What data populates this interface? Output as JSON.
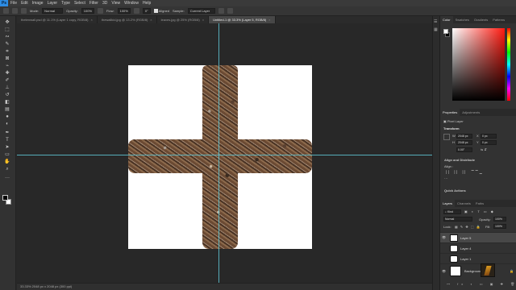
{
  "menu": {
    "logo": "Ps",
    "items": [
      "File",
      "Edit",
      "Image",
      "Layer",
      "Type",
      "Select",
      "Filter",
      "3D",
      "View",
      "Window",
      "Help"
    ]
  },
  "options": {
    "mode_label": "Mode:",
    "mode_value": "Normal",
    "opacity_label": "Opacity:",
    "opacity_value": "100%",
    "flow_label": "Flow:",
    "flow_value": "100%",
    "angle_value": "0°",
    "aligned_label": "Aligned",
    "sample_label": "Sample:",
    "sample_value": "Current Layer"
  },
  "tabs": [
    {
      "label": "thetenwall.psd @ 11.1% (Layer 1 copy, RGB/8)",
      "active": false
    },
    {
      "label": "thewallkid.jpg @ 13.2% (RGB/8)",
      "active": false
    },
    {
      "label": "leaves.jpg @ 25% (RGB/8)",
      "active": false
    },
    {
      "label": "Untitled-1 @ 33.3% (Layer 5, RGB/8)",
      "active": true
    }
  ],
  "status": {
    "text": "33.33%    2048 px x 2048 px (300 ppi)"
  },
  "color_panel": {
    "tabs": [
      "Color",
      "Swatches",
      "Gradients",
      "Patterns"
    ],
    "foreground": "#ffffff",
    "background": "#000000"
  },
  "properties_panel": {
    "tabs": [
      "Properties",
      "Adjustments"
    ],
    "layer_type": "Pixel Layer",
    "transform_title": "Transform",
    "w_label": "W",
    "w_value": "2048 px",
    "h_label": "H",
    "h_value": "2048 px",
    "x_label": "X",
    "x_value": "0 px",
    "y_label": "Y",
    "y_value": "0 px",
    "angle_value": "0.00°",
    "align_title": "Align and Distribute",
    "align_sub": "Align :",
    "quick_actions_title": "Quick Actions"
  },
  "layers_panel": {
    "tabs": [
      "Layers",
      "Channels",
      "Paths"
    ],
    "kind_label": "Kind",
    "blend_mode": "Normal",
    "opacity_label": "Opacity:",
    "opacity_value": "100%",
    "lock_label": "Lock:",
    "fill_label": "Fill:",
    "fill_value": "100%",
    "layers": [
      {
        "name": "Layer 5",
        "selected": true,
        "visible": true
      },
      {
        "name": "Layer 4",
        "selected": false,
        "visible": false
      },
      {
        "name": "Layer 1",
        "selected": false,
        "visible": false
      },
      {
        "name": "Background",
        "selected": false,
        "visible": true
      }
    ]
  },
  "icons": [
    "move-icon",
    "marquee-icon",
    "lasso-icon",
    "quick-select-icon",
    "crop-icon",
    "frame-icon",
    "eyedropper-icon",
    "healing-icon",
    "brush-icon",
    "clone-stamp-icon",
    "history-brush-icon",
    "eraser-icon",
    "gradient-icon",
    "blur-icon",
    "dodge-icon",
    "pen-icon",
    "type-icon",
    "path-select-icon",
    "rectangle-icon",
    "hand-icon",
    "zoom-icon",
    "more-tools-icon"
  ],
  "colors": {
    "guide": "#5ec4d4",
    "panel_bg": "#323232",
    "canvas_bg": "#282828",
    "accent": "#2d8ce3"
  }
}
